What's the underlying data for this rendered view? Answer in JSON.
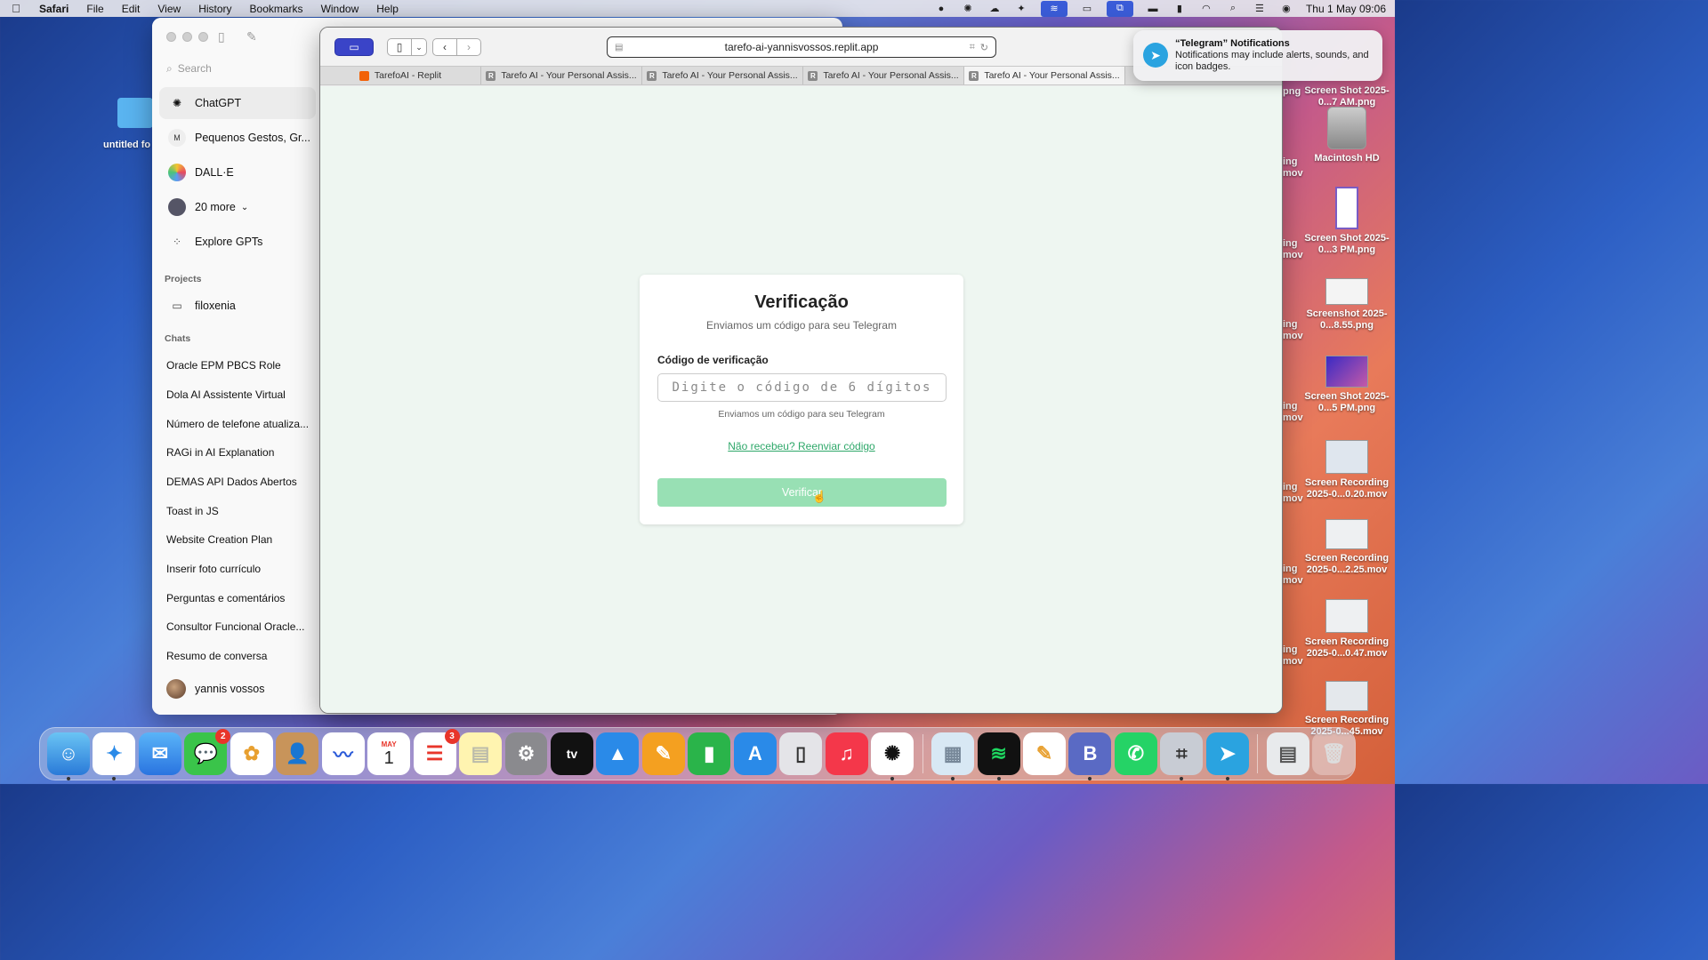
{
  "menubar": {
    "app": "Safari",
    "items": [
      "File",
      "Edit",
      "View",
      "History",
      "Bookmarks",
      "Window",
      "Help"
    ],
    "clock": "Thu 1 May  09:06"
  },
  "desktop": {
    "folder_label": "untitled fo",
    "right_icons": [
      {
        "label": "Screen Shot 2025-0...7 AM.png"
      },
      {
        "label": "Macintosh HD"
      },
      {
        "label": "Screen Shot 2025-0...3 PM.png"
      },
      {
        "label": "Screenshot 2025-0...8.55.png"
      },
      {
        "label": "Screen Shot 2025-0...5 PM.png"
      },
      {
        "label": "Screen Recording 2025-0...0.20.mov"
      },
      {
        "label": "Screen Recording 2025-0...2.25.mov"
      },
      {
        "label": "Screen Recording 2025-0...0.47.mov"
      },
      {
        "label": "Screen Recording 2025-0...45.mov"
      }
    ],
    "partial_labels": [
      "png",
      "ing mov",
      "ing mov",
      "ing mov",
      "ing mov",
      "ing mov",
      "ing mov",
      "ing mov"
    ]
  },
  "gpt": {
    "search_placeholder": "Search",
    "nav": [
      {
        "label": "ChatGPT",
        "icon": "openai-icon"
      },
      {
        "label": "Pequenos Gestos, Gr...",
        "icon": "gpt-custom-icon"
      },
      {
        "label": "DALL·E",
        "icon": "dalle-icon"
      },
      {
        "label": "20 more",
        "icon": "gpts-avatars-icon"
      },
      {
        "label": "Explore GPTs",
        "icon": "grid-icon"
      }
    ],
    "projects_heading": "Projects",
    "project": "filoxenia",
    "chats_heading": "Chats",
    "chats": [
      "Oracle EPM PBCS Role",
      "Dola AI Assistente Virtual",
      "Número de telefone atualiza...",
      "RAGi in AI Explanation",
      "DEMAS API Dados Abertos",
      "Toast in JS",
      "Website Creation Plan",
      "Inserir foto currículo",
      "Perguntas e comentários",
      "Consultor Funcional Oracle...",
      "Resumo de conversa"
    ],
    "user": "yannis vossos"
  },
  "safari": {
    "url": "tarefo-ai-yannisvossos.replit.app",
    "tabs": [
      {
        "label": "TarefoAI - Replit",
        "fav": "replit"
      },
      {
        "label": "Tarefo AI - Your Personal Assis...",
        "fav": "R"
      },
      {
        "label": "Tarefo AI - Your Personal Assis...",
        "fav": "R"
      },
      {
        "label": "Tarefo AI - Your Personal Assis...",
        "fav": "R"
      },
      {
        "label": "Tarefo AI - Your Personal Assis...",
        "fav": "R"
      }
    ]
  },
  "verify": {
    "title": "Verificação",
    "subtitle": "Enviamos um código para seu Telegram",
    "code_label": "Código de verificação",
    "code_placeholder": "Digite o código de 6 dígitos",
    "hint": "Enviamos um código para seu Telegram",
    "resend": "Não recebeu? Reenviar código",
    "submit": "Verificar"
  },
  "notification": {
    "title": "“Telegram” Notifications",
    "body": "Notifications may include alerts, sounds, and icon badges."
  },
  "dock": {
    "badges": {
      "messages": "2",
      "reminders": "3"
    },
    "calendar_month": "MAY",
    "calendar_day": "1",
    "apps": [
      "finder-icon",
      "safari-icon",
      "mail-icon",
      "messages-icon",
      "photos-icon",
      "contacts-icon",
      "freeform-icon",
      "calendar-icon",
      "reminders-icon",
      "notes-icon",
      "system-settings-icon",
      "appletv-icon",
      "keynote-icon",
      "pages-icon",
      "numbers-icon",
      "appstore-icon",
      "iphone-mirroring-icon",
      "music-icon",
      "chatgpt-icon",
      "preview-icon",
      "spotify-icon",
      "textedit-icon",
      "bbedit-icon",
      "whatsapp-icon",
      "screenshot-icon",
      "telegram-icon",
      "downloads-icon",
      "trash-icon"
    ]
  }
}
